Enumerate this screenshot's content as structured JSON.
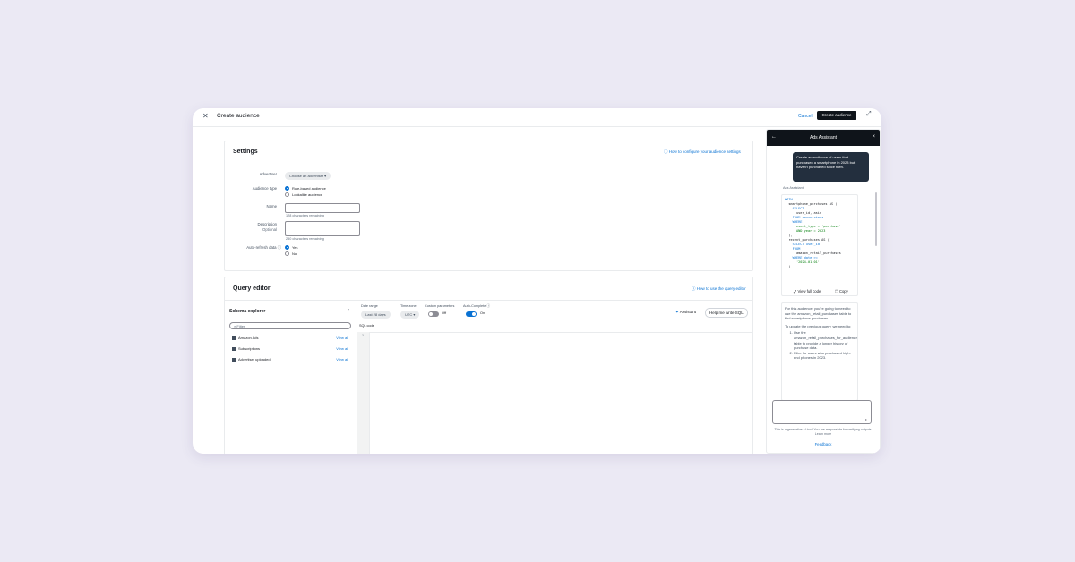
{
  "header": {
    "close_icon": "close-icon",
    "title": "Create audience",
    "cancel": "Cancel",
    "create": "Create audience",
    "expand_icon": "expand-icon"
  },
  "settings": {
    "title": "Settings",
    "help_link": "ⓘ How to configure your audience settings",
    "advertiser_label": "Advertiser",
    "advertiser_value": "Choose an advertiser ▾",
    "audience_type_label": "Audience type",
    "audience_type_options": [
      "Rule-based audience",
      "Lookalike audience"
    ],
    "name_label": "Name",
    "name_hint": "128 characters remaining",
    "description_label": "Description",
    "description_sub": "Optional",
    "description_hint": "250 characters remaining",
    "refresh_label": "Auto-refresh data ⓘ",
    "refresh_options": [
      "Yes",
      "No"
    ]
  },
  "query_editor": {
    "title": "Query editor",
    "help_link": "ⓘ How to use the query editor",
    "schema": {
      "title": "Schema explorer",
      "collapse": "‹",
      "search_placeholder": "Filter",
      "tables": [
        {
          "name": "Amazon Ads",
          "action": "View all"
        },
        {
          "name": "Subscriptions",
          "action": "View all"
        },
        {
          "name": "Advertiser uploaded",
          "action": "View all"
        }
      ]
    },
    "toolbar": {
      "date_label": "Date range",
      "date_value": "Last 28 days",
      "timezone_label": "Time zone",
      "timezone_value": "UTC ▾",
      "custom_label": "Custom parameters",
      "custom_value": "Off",
      "autocomplete_label": "Auto-Complete ⓘ",
      "autocomplete_value": "On",
      "assistant_btn": "Assistant",
      "help_btn": "Help me write SQL"
    },
    "sql_label": "SQL code",
    "line_numbers": [
      "1"
    ]
  },
  "assistant": {
    "title": "Ads Assistant",
    "back": "←",
    "close": "×",
    "user_message": "Create an audience of users that purchased a smartphone in 2023 but haven't purchased since then.",
    "assistant_label": "Ads Assistant",
    "code_lines": [
      "WITH",
      "  smartphone_purchases AS (",
      "    SELECT",
      "      user_id, asin",
      "    FROM conversions",
      "    WHERE",
      "      event_type = 'purchase'",
      "      AND year = 2023",
      "  ),",
      "  recent_purchases AS (",
      "    SELECT user_id",
      "    FROM",
      "      amazon_retail_purchases",
      "    WHERE date >=",
      "      '2024-01-01'",
      "  )"
    ],
    "view_full": "View full code",
    "copy": "Copy",
    "response_p1": "For this audience, you're going to need to use the amazon_retail_purchases table to find smartphone purchases.",
    "response_p2": "To update the previous query, we need to:",
    "response_list": [
      "Use the amazon_retail_purchases_for_audiences table to provide a longer history of purchase data.",
      "Filter for users who purchased high-end phones in 2023."
    ],
    "disclaimer": "This is a generative AI tool. You are responsible for verifying outputs. Learn more",
    "feedback": "Feedback"
  }
}
